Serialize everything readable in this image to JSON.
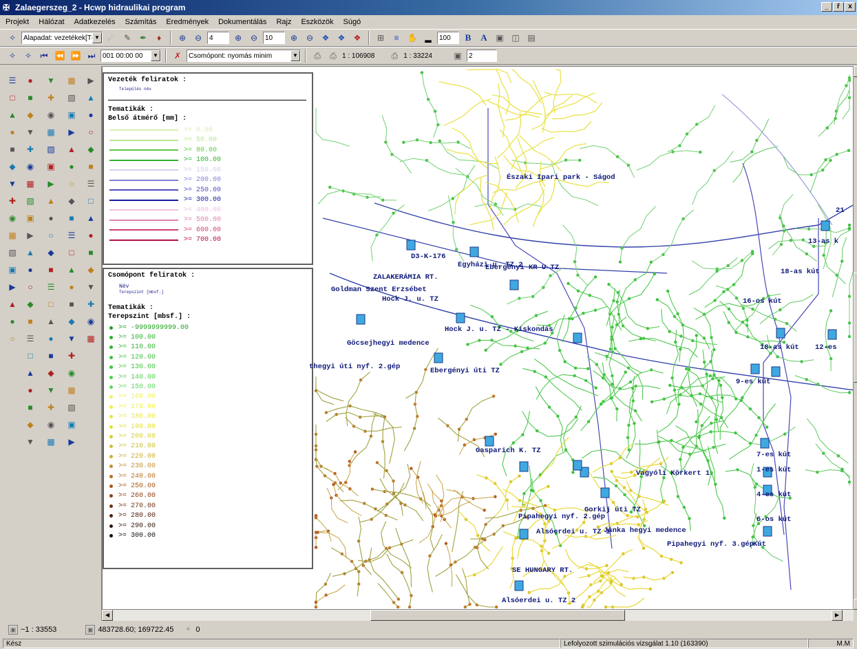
{
  "window": {
    "title": "Zalaegerszeg_2 - Hcwp hidraulikai program",
    "buttons": [
      "_",
      "ř",
      "x"
    ]
  },
  "menu": [
    "Projekt",
    "Hálózat",
    "Adatkezelés",
    "Számítás",
    "Eredmények",
    "Dokumentálás",
    "Rajz",
    "Eszközök",
    "Súgó"
  ],
  "toolbar1": {
    "layer_combo": "Alapadat: vezetékek[T-DL",
    "zoom1": "4",
    "zoom2": "10",
    "size_field": "100",
    "bold_label": "B",
    "font_label": "A"
  },
  "toolbar2": {
    "time_combo": "001 00:00 00",
    "node_combo": "Csomópont: nyomás minim",
    "scale1": "1 : 106908",
    "scale2": "1 : 33224",
    "count": "2"
  },
  "legend_pipes": {
    "title": "Vezeték feliratok :",
    "sub": "Település név",
    "thematic": "Tematikák :",
    "attribute": "Belső átmérő [mm] :",
    "rows": [
      {
        "label": ">= 0.00",
        "color": "#d8f0b0"
      },
      {
        "label": ">= 50.00",
        "color": "#b8e890"
      },
      {
        "label": ">= 80.00",
        "color": "#60c840"
      },
      {
        "label": ">= 100.00",
        "color": "#30b030"
      },
      {
        "label": ">= 150.00",
        "color": "#d0d0f0"
      },
      {
        "label": ">= 200.00",
        "color": "#8080d8"
      },
      {
        "label": ">= 250.00",
        "color": "#5050c0"
      },
      {
        "label": ">= 300.00",
        "color": "#1818a0"
      },
      {
        "label": ">= 400.00",
        "color": "#f0c0e0"
      },
      {
        "label": ">= 500.00",
        "color": "#e080b0"
      },
      {
        "label": ">= 600.00",
        "color": "#d04070"
      },
      {
        "label": ">= 700.00",
        "color": "#b01040"
      }
    ]
  },
  "legend_nodes": {
    "title": "Csomópont feliratok :",
    "sub1": "Név",
    "sub2": "Terepszint [mbsf.]",
    "thematic": "Tematikák :",
    "attribute": "Terepszint [mbsf.] :",
    "rows": [
      {
        "label": ">= -9999999999.00",
        "color": "#20a020"
      },
      {
        "label": ">= 100.00",
        "color": "#30b030"
      },
      {
        "label": ">= 110.00",
        "color": "#30b830"
      },
      {
        "label": ">= 120.00",
        "color": "#40c040"
      },
      {
        "label": ">= 130.00",
        "color": "#40c840"
      },
      {
        "label": ">= 140.00",
        "color": "#50d050"
      },
      {
        "label": ">= 150.00",
        "color": "#60d860"
      },
      {
        "label": ">= 160.00",
        "color": "#f0f060"
      },
      {
        "label": ">= 170.00",
        "color": "#f0f040"
      },
      {
        "label": ">= 180.00",
        "color": "#e8e840"
      },
      {
        "label": ">= 190.00",
        "color": "#e0e030"
      },
      {
        "label": ">= 200.00",
        "color": "#d8d030"
      },
      {
        "label": ">= 210.00",
        "color": "#d0c030"
      },
      {
        "label": ">= 220.00",
        "color": "#c8b030"
      },
      {
        "label": ">= 230.00",
        "color": "#c09030"
      },
      {
        "label": ">= 240.00",
        "color": "#b87020"
      },
      {
        "label": ">= 250.00",
        "color": "#a85818"
      },
      {
        "label": ">= 260.00",
        "color": "#904010"
      },
      {
        "label": ">= 270.00",
        "color": "#703010"
      },
      {
        "label": ">= 280.00",
        "color": "#502008"
      },
      {
        "label": ">= 290.00",
        "color": "#301808"
      },
      {
        "label": ">= 300.00",
        "color": "#101010"
      }
    ]
  },
  "map_labels": [
    "Északi Ipari park - Ságod",
    "D3-K-176",
    "Egyházi u. TZ 2",
    "Ebergényi KR U TZ",
    "Goldman Szent Erzsébet",
    "Hock J. u. TZ",
    "Hock J. u. TZ - Kiskondás",
    "Göcsejhegyi medence",
    "thegyi úti nyf. 2.gép",
    "Ebergényi úti TZ",
    "16-os kút",
    "18-as kút",
    "18-as kút",
    "12-es",
    "13-as k",
    "9-es kút",
    "Gasparich K. TZ",
    "Alsóerdei u. TZ 1",
    "Gorkij úti TZ",
    "Jánka hegyi medence",
    "Pipahegyi nyf. 3.gép",
    "Pipahegyi nyf. 2.gép",
    "SE HUNGARY RT.",
    "Alsóerdei u. TZ 2",
    "7-es kút",
    "1-es kút",
    "4-es kút",
    "6-os kút",
    "Kút",
    "21",
    "Vagyóli Körkert 1.",
    "ZALAKERÁMIA RT."
  ],
  "status": {
    "scale": "~1 : 33553",
    "coords": "483728.60; 169722.45",
    "count": "0",
    "ready": "Kész",
    "sim": "Lefolyozott szimulációs vizsgálat 1.10 (163390)",
    "right": "M.M"
  }
}
